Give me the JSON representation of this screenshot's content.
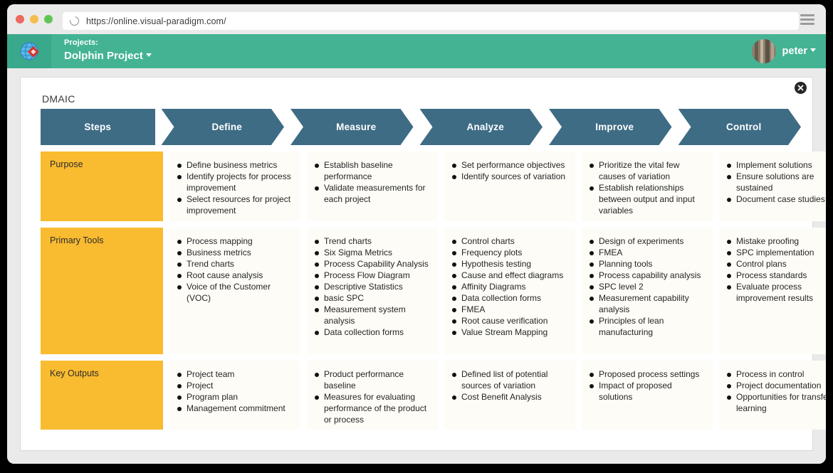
{
  "browser": {
    "url": "https://online.visual-paradigm.com/",
    "reload_icon": "reload-icon",
    "menu_icon": "hamburger-menu-icon"
  },
  "appbar": {
    "logo_icon": "visual-paradigm-logo-icon",
    "projects_label": "Projects:",
    "project_name": "Dolphin Project",
    "project_caret_icon": "caret-down-icon",
    "user_name": "peter",
    "user_caret_icon": "caret-down-icon",
    "avatar_icon": "user-avatar",
    "green": "#44b394"
  },
  "card": {
    "title": "DMAIC",
    "close_icon": "close-icon"
  },
  "chart_data": {
    "type": "table",
    "title": "DMAIC",
    "header_color": "#3e6c85",
    "label_color": "#f9bb30",
    "cell_color": "#fdfcf6",
    "columns": [
      "Steps",
      "Define",
      "Measure",
      "Analyze",
      "Improve",
      "Control"
    ],
    "rows": [
      {
        "label": "Purpose",
        "cells": [
          [
            "Define business metrics",
            "Identify projects for process improvement",
            "Select resources for project improvement"
          ],
          [
            "Establish baseline performance",
            "Validate measurements for each project"
          ],
          [
            "Set performance objectives",
            "Identify sources of variation"
          ],
          [
            "Prioritize the vital few causes of variation",
            "Establish relationships between output and input variables"
          ],
          [
            "Implement solutions",
            "Ensure solutions are sustained",
            "Document case studies"
          ]
        ]
      },
      {
        "label": "Primary Tools",
        "cells": [
          [
            "Process mapping",
            "Business metrics",
            "Trend charts",
            "Root cause analysis",
            "Voice of the Customer (VOC)"
          ],
          [
            "Trend charts",
            "Six Sigma Metrics",
            "Process Capability Analysis",
            "Process Flow Diagram",
            "Descriptive Statistics",
            "basic SPC",
            "Measurement system analysis",
            "Data collection forms"
          ],
          [
            "Control charts",
            "Frequency plots",
            "Hypothesis testing",
            "Cause and effect diagrams",
            "Affinity Diagrams",
            "Data collection forms",
            "FMEA",
            "Root cause verification",
            "Value Stream Mapping"
          ],
          [
            "Design of experiments",
            "FMEA",
            "Planning tools",
            "Process capability analysis",
            "SPC level 2",
            "Measurement capability analysis",
            "Principles of lean manufacturing"
          ],
          [
            "Mistake proofing",
            "SPC implementation",
            "Control plans",
            "Process standards",
            "Evaluate process improvement results"
          ]
        ]
      },
      {
        "label": "Key Outputs",
        "cells": [
          [
            "Project team",
            "Project",
            "Program plan",
            "Management commitment"
          ],
          [
            "Product performance baseline",
            "Measures for evaluating performance of the product or process"
          ],
          [
            "Defined list of potential sources of variation",
            "Cost Benefit Analysis"
          ],
          [
            "Proposed process settings",
            "Impact of proposed solutions"
          ],
          [
            "Process in control",
            "Project documentation",
            "Opportunities for transfer of learning"
          ]
        ]
      }
    ]
  }
}
